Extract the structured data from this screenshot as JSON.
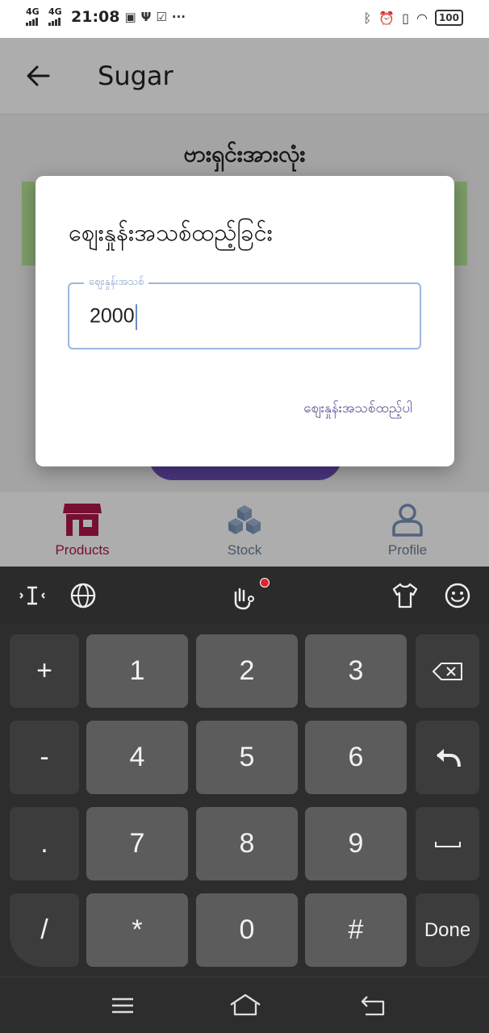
{
  "status": {
    "net1": "4G",
    "net2": "4G",
    "time": "21:08",
    "dots": "···",
    "battery": "100"
  },
  "appbar": {
    "title": "Sugar"
  },
  "main": {
    "section_title": "ဗားရှင်းအားလုံး"
  },
  "dialog": {
    "title": "စျေးနှုန်းအသစ်ထည့်ခြင်း",
    "field_label": "စျေးနှုန်းအသစ်",
    "field_value": "2000",
    "action_label": "စျေးနှုန်းအသစ်ထည့်ပါ"
  },
  "bottom_nav": {
    "items": [
      {
        "label": "Products",
        "icon": "store-icon",
        "active": true
      },
      {
        "label": "Stock",
        "icon": "boxes-icon",
        "active": false
      },
      {
        "label": "Profile",
        "icon": "person-icon",
        "active": false
      }
    ]
  },
  "keyboard": {
    "rows": [
      [
        "+",
        "1",
        "2",
        "3",
        "backspace"
      ],
      [
        "-",
        "4",
        "5",
        "6",
        "enter"
      ],
      [
        ".",
        "7",
        "8",
        "9",
        "space"
      ],
      [
        "/",
        "*",
        "0",
        "#",
        "Done"
      ]
    ],
    "labels": {
      "plus": "+",
      "k1": "1",
      "k2": "2",
      "k3": "3",
      "minus": "-",
      "k4": "4",
      "k5": "5",
      "k6": "6",
      "dot": ".",
      "k7": "7",
      "k8": "8",
      "k9": "9",
      "slash": "/",
      "star": "*",
      "k0": "0",
      "hash": "#",
      "done": "Done"
    }
  },
  "colors": {
    "accent_active": "#b0174a",
    "nav_inactive": "#6a7f99",
    "dialog_field_border": "#9db6dc",
    "keyboard_bg": "#2d2d2d"
  }
}
